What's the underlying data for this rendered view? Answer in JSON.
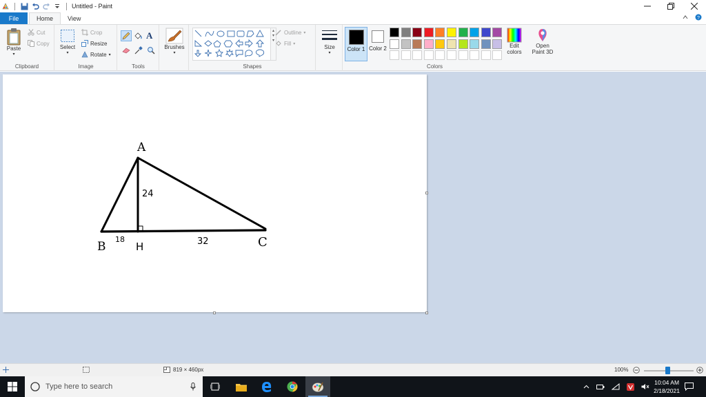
{
  "window": {
    "title": "Untitled - Paint"
  },
  "tabs": {
    "file": "File",
    "home": "Home",
    "view": "View"
  },
  "ribbon": {
    "clipboard": {
      "label": "Clipboard",
      "paste": "Paste",
      "cut": "Cut",
      "copy": "Copy"
    },
    "image": {
      "label": "Image",
      "select": "Select",
      "crop": "Crop",
      "resize": "Resize",
      "rotate": "Rotate"
    },
    "tools": {
      "label": "Tools"
    },
    "brushes": {
      "label": "Brushes"
    },
    "shapes": {
      "label": "Shapes",
      "outline": "Outline",
      "fill": "Fill"
    },
    "size": {
      "label": "Size"
    },
    "colors": {
      "label": "Colors",
      "color1": "Color 1",
      "color2": "Color 2",
      "edit": "Edit colors",
      "paint3d": "Open Paint 3D",
      "palette_row1": [
        "#000000",
        "#7f7f7f",
        "#880015",
        "#ed1c24",
        "#ff7f27",
        "#fff200",
        "#22b14c",
        "#00a2e8",
        "#3f48cc",
        "#a349a4"
      ],
      "palette_row2": [
        "#ffffff",
        "#c3c3c3",
        "#b97a57",
        "#ffaec9",
        "#ffc90e",
        "#efe4b0",
        "#b5e61d",
        "#99d9ea",
        "#7092be",
        "#c8bfe7"
      ],
      "color1_value": "#000000",
      "color2_value": "#ffffff"
    }
  },
  "drawing": {
    "labels": {
      "A": "A",
      "B": "B",
      "C": "C",
      "H": "H",
      "height": "24",
      "bh": "18",
      "hc": "32"
    }
  },
  "statusbar": {
    "dimensions": "819 × 460px",
    "zoom": "100%"
  },
  "taskbar": {
    "search_placeholder": "Type here to search",
    "time": "10:04 AM",
    "date": "2/18/2021"
  }
}
